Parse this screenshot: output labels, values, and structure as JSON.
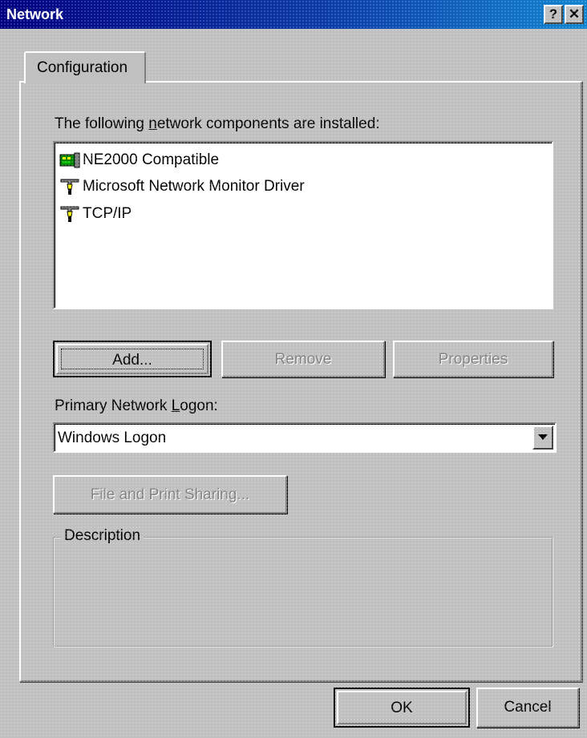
{
  "window": {
    "title": "Network",
    "help_label": "?",
    "close_label": "✕"
  },
  "tabs": [
    {
      "label": "Configuration"
    }
  ],
  "components": {
    "label": "The following network components are installed:",
    "items": [
      {
        "label": "NE2000 Compatible",
        "icon": "network-adapter-icon"
      },
      {
        "label": "Microsoft Network Monitor Driver",
        "icon": "network-protocol-icon"
      },
      {
        "label": "TCP/IP",
        "icon": "network-protocol-icon"
      }
    ]
  },
  "buttons": {
    "add": "Add...",
    "remove": "Remove",
    "properties": "Properties",
    "file_print_sharing": "File and Print Sharing...",
    "ok": "OK",
    "cancel": "Cancel"
  },
  "logon": {
    "label": "Primary Network Logon:",
    "value": "Windows Logon"
  },
  "description": {
    "legend": "Description",
    "text": ""
  },
  "colors": {
    "titlebar_start": "#000080",
    "titlebar_end": "#1084d0",
    "face": "#c0c0c0"
  }
}
